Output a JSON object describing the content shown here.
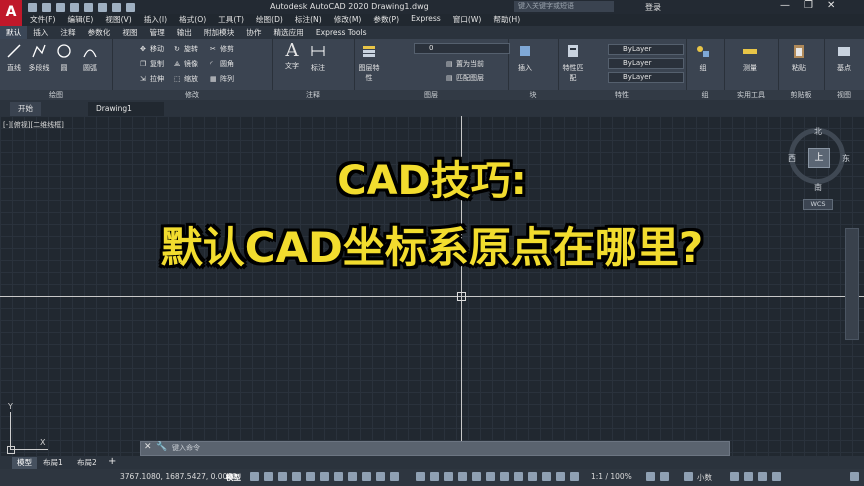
{
  "title_bar": {
    "title": "Autodesk AutoCAD 2020    Drawing1.dwg",
    "search_placeholder": "键入关键字或短语",
    "login": "登录",
    "app_logo": "A"
  },
  "menu": [
    "文件(F)",
    "编辑(E)",
    "视图(V)",
    "插入(I)",
    "格式(O)",
    "工具(T)",
    "绘图(D)",
    "标注(N)",
    "修改(M)",
    "参数(P)",
    "Express",
    "窗口(W)",
    "帮助(H)"
  ],
  "ribbon_tabs": [
    "默认",
    "插入",
    "注释",
    "参数化",
    "视图",
    "管理",
    "输出",
    "附加模块",
    "协作",
    "精选应用",
    "Express Tools"
  ],
  "ribbon": {
    "draw": {
      "label": "绘图",
      "tools": [
        "直线",
        "多段线",
        "圆",
        "圆弧"
      ]
    },
    "modify": {
      "label": "修改",
      "tools": [
        "移动",
        "旋转",
        "修剪",
        "复制",
        "镜像",
        "圆角",
        "拉伸",
        "缩放",
        "阵列"
      ]
    },
    "annotation": {
      "label": "注释",
      "tools": [
        "文字",
        "标注"
      ]
    },
    "layers": {
      "label": "图层",
      "tools": [
        "图层特性",
        "置为当前",
        "匹配图层"
      ],
      "current_layer": "0"
    },
    "block": {
      "label": "块",
      "tools": [
        "插入"
      ]
    },
    "properties": {
      "label": "特性",
      "tools": [
        "特性匹配"
      ],
      "values": [
        "ByLayer",
        "ByLayer",
        "ByLayer"
      ]
    },
    "group": {
      "label": "组",
      "tools": [
        "组"
      ]
    },
    "utilities": {
      "label": "实用工具",
      "tools": [
        "测量"
      ]
    },
    "clipboard": {
      "label": "剪贴板",
      "tools": [
        "粘贴"
      ]
    },
    "view": {
      "label": "视图",
      "tools": [
        "基点"
      ]
    }
  },
  "file_tabs": [
    "开始",
    "Drawing1"
  ],
  "viewport_label": "[-][俯视][二维线框]",
  "captions": {
    "line1": "CAD技巧:",
    "line2": "默认CAD坐标系原点在哪里?"
  },
  "viewcube": {
    "top": "上",
    "north": "北",
    "south": "南",
    "east": "东",
    "west": "西",
    "wcs": "WCS"
  },
  "ucs": {
    "y": "Y",
    "x": "X"
  },
  "command": {
    "placeholder": "键入命令"
  },
  "layout_tabs": [
    "模型",
    "布局1",
    "布局2"
  ],
  "status": {
    "coords": "3767.1080, 1687.5427, 0.0000",
    "model": "模型",
    "scale": "1:1 / 100%",
    "small": "小数"
  }
}
